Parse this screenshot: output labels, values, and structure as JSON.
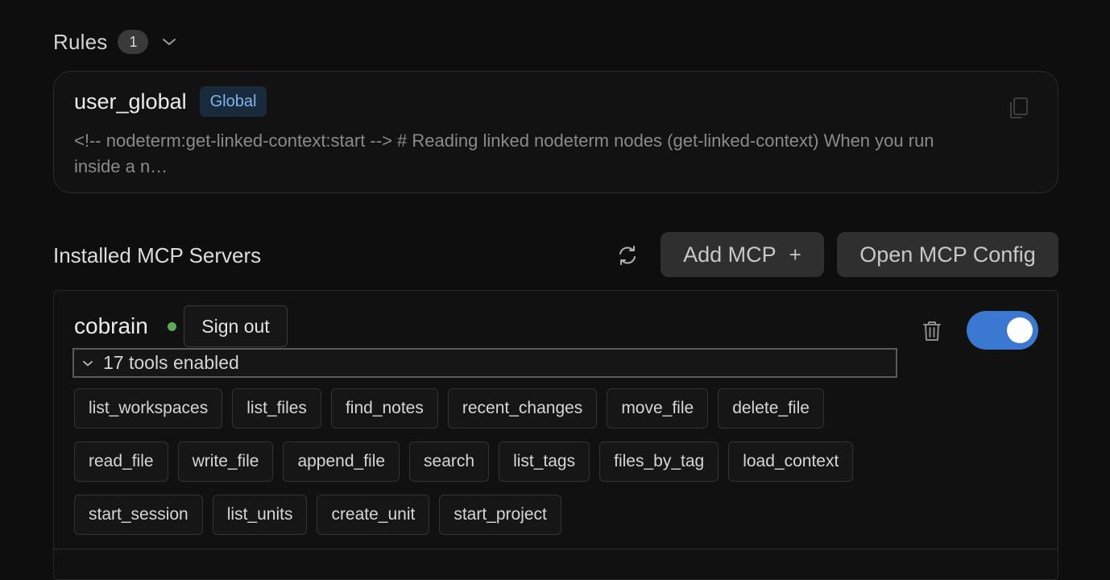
{
  "rules": {
    "title": "Rules",
    "count": "1",
    "items": [
      {
        "name": "user_global",
        "scope": "Global",
        "preview": "<!-- nodeterm:get-linked-context:start --> # Reading linked nodeterm nodes (get-linked-context) When you run inside a n…"
      }
    ]
  },
  "mcp": {
    "title": "Installed MCP Servers",
    "add_label": "Add MCP",
    "add_icon": "+",
    "config_label": "Open MCP Config",
    "servers": [
      {
        "name": "cobrain",
        "status": "connected",
        "status_color": "#5fa85a",
        "sign_out_label": "Sign out",
        "tools_summary": "17 tools enabled",
        "enabled": true,
        "tool_rows": [
          [
            "list_workspaces",
            "list_files",
            "find_notes",
            "recent_changes",
            "move_file",
            "delete_file"
          ],
          [
            "read_file",
            "write_file",
            "append_file",
            "search",
            "list_tags",
            "files_by_tag",
            "load_context"
          ],
          [
            "start_session",
            "list_units",
            "create_unit",
            "start_project"
          ]
        ]
      }
    ]
  },
  "colors": {
    "background": "#0e0e0e",
    "accent": "#3a78d2",
    "badge_blue": "#7fb4e6"
  }
}
